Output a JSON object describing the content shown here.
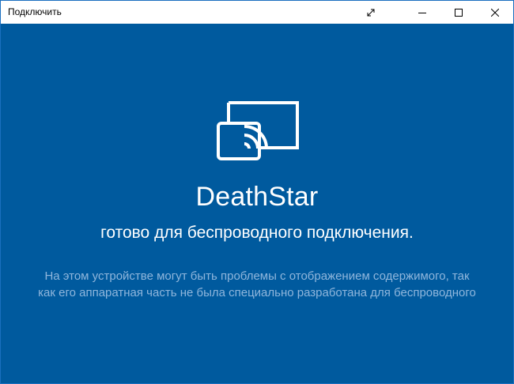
{
  "window": {
    "title": "Подключить",
    "buttons": {
      "fullscreen_icon": "expand-icon",
      "minimize_icon": "minimize-icon",
      "maximize_icon": "maximize-icon",
      "close_icon": "close-icon"
    }
  },
  "main": {
    "icon": "wireless-cast-icon",
    "device_name": "DeathStar",
    "status": "готово для беспроводного подключения.",
    "warning_line1": "На этом устройстве могут быть проблемы с отображением содержимого, так",
    "warning_line2": "как его аппаратная часть не была специально разработана для беспроводного"
  },
  "colors": {
    "background": "#005a9e",
    "text": "#ffffff",
    "muted_text": "#8fb6dc"
  }
}
